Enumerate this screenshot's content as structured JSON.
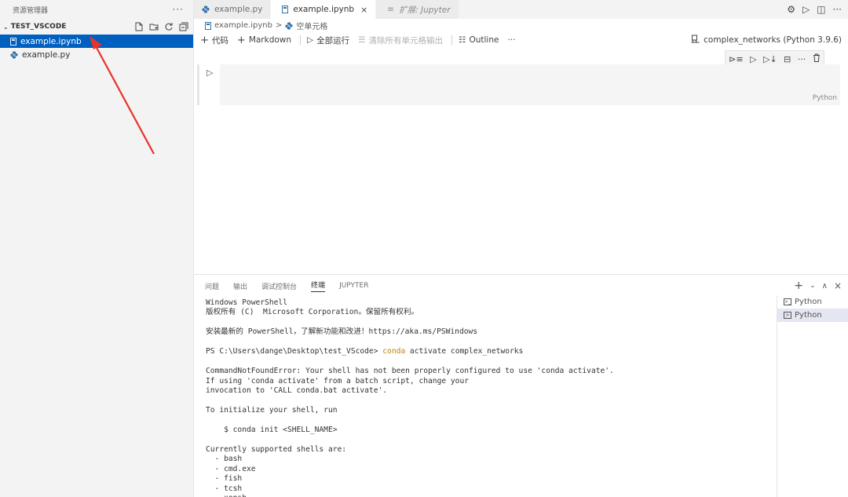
{
  "sidebar": {
    "title": "资源管理器",
    "more": "···",
    "folder": "TEST_VSCODE",
    "files": [
      {
        "name": "example.ipynb",
        "icon": "notebook-icon",
        "active": true
      },
      {
        "name": "example.py",
        "icon": "python-icon",
        "active": false
      }
    ]
  },
  "tabs": [
    {
      "label": "example.py",
      "icon": "python-icon",
      "active": false
    },
    {
      "label": "example.ipynb",
      "icon": "notebook-icon",
      "active": true,
      "close": "×"
    },
    {
      "label": "扩展: Jupyter",
      "icon": "extension-icon",
      "active": false,
      "italic": true
    }
  ],
  "tab_right_more": "···",
  "breadcrumb": {
    "file": "example.ipynb",
    "separator": ">",
    "cell": "空单元格"
  },
  "toolbar": {
    "code": "代码",
    "markdown": "Markdown",
    "run_all": "全部运行",
    "clear_outputs": "清除所有单元格输出",
    "outline": "Outline",
    "more": "···",
    "kernel": "complex_networks (Python 3.9.6)"
  },
  "cell": {
    "language": "Python"
  },
  "cell_toolbar_more": "···",
  "panel": {
    "tabs": [
      "问题",
      "输出",
      "调试控制台",
      "终端",
      "JUPYTER"
    ],
    "active_tab": 3,
    "terminal_lines": [
      "Windows PowerShell",
      "版权所有 (C)  Microsoft Corporation。保留所有权利。",
      "",
      "安装最新的 PowerShell，了解新功能和改进！https://aka.ms/PSWindows",
      "",
      "PS C:\\Users\\dange\\Desktop\\test_VScode> conda activate complex_networks",
      "",
      "CommandNotFoundError: Your shell has not been properly configured to use 'conda activate'.",
      "If using 'conda activate' from a batch script, change your",
      "invocation to 'CALL conda.bat activate'.",
      "",
      "To initialize your shell, run",
      "",
      "    $ conda init <SHELL_NAME>",
      "",
      "Currently supported shells are:",
      "  - bash",
      "  - cmd.exe",
      "  - fish",
      "  - tcsh",
      "  - xonsh"
    ],
    "terminals": [
      {
        "label": "Python",
        "active": false
      },
      {
        "label": "Python",
        "active": true
      }
    ]
  },
  "colors": {
    "accent": "#0060c0",
    "arrow": "#e8322b",
    "conda_cmd": "#b8860b"
  }
}
